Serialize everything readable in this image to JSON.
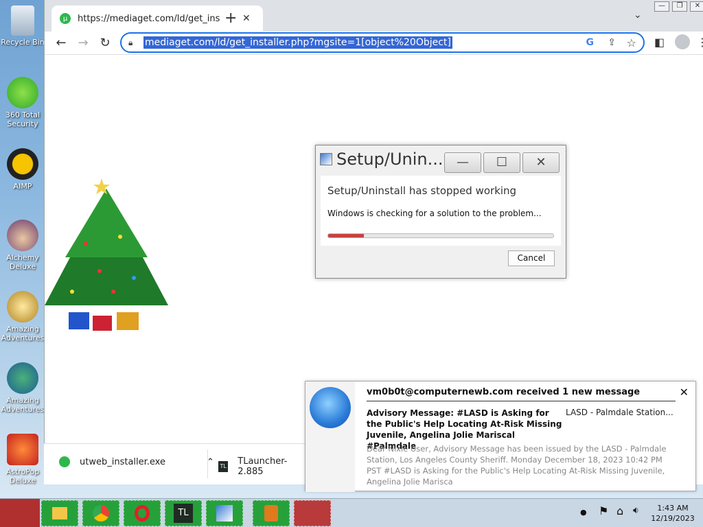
{
  "desktop": {
    "icons": [
      {
        "label": "Recycle Bin",
        "icon": "recycle-bin-icon"
      },
      {
        "label": "360 Total Security",
        "icon": "360-total-security-icon"
      },
      {
        "label": "AIMP",
        "icon": "aimp-icon"
      },
      {
        "label": "Alchemy Deluxe",
        "icon": "alchemy-icon"
      },
      {
        "label": "Amazing Adventures",
        "icon": "amazing-adventures-icon"
      },
      {
        "label": "Amazing Adventures",
        "icon": "amazing-adventures-2-icon"
      },
      {
        "label": "AstroPop Deluxe",
        "icon": "astropop-icon"
      }
    ]
  },
  "browser": {
    "tab_title": "https://mediaget.com/ld/get_ins",
    "url": "mediaget.com/ld/get_installer.php?mgsite=1[object%20Object]"
  },
  "dialog": {
    "title": "Setup/Unin...",
    "heading": "Setup/Uninstall has stopped working",
    "message": "Windows is checking for a solution to the problem...",
    "progress": 0.16,
    "cancel_label": "Cancel"
  },
  "downloads": [
    {
      "name": "utweb_installer.exe"
    },
    {
      "name": "TLauncher-2.885"
    }
  ],
  "notification": {
    "header": "vm0b0t@computernewb.com received 1 new message",
    "subject": "Advisory Message: #LASD is Asking for the Public's Help Locating At-Risk Missing Juvenile, Angelina Jolie Mariscal #Palmdale",
    "sender": "LASD - Palmdale Station...",
    "body": "Dear Nixle User, Advisory Message has been issued by the LASD - Palmdale Station, Los Angeles County Sheriff. Monday December 18, 2023 10:42 PM PST #LASD is Asking for the Public's Help Locating At-Risk Missing Juvenile, Angelina Jolie Marisca"
  },
  "taskbar": {
    "time": "1:43 AM",
    "date": "12/19/2023"
  }
}
